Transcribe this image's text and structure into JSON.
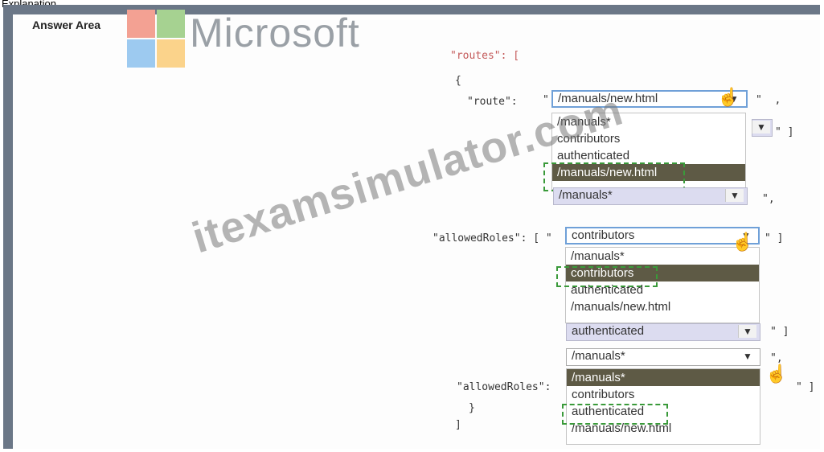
{
  "caption": "Explanation",
  "answer_area": "Answer Area",
  "logo_text": "Microsoft",
  "watermark": "itexamsimulator.com",
  "code": {
    "routes_line": "\"routes\": [",
    "open_brace": "{",
    "route_key": "\"route\":",
    "quote": "\"",
    "comma_after": "\"  ,",
    "close_bracket_1": "\" ]",
    "after_mid": "\",",
    "allowed_roles_1": "\"allowedRoles\": [ \"",
    "close_after_c": "\" ]",
    "close_after_auth": "\" ]",
    "after_manuals": "\",",
    "allowed_roles_2": "\"allowedRoles\":",
    "close_after_last": "\" ]",
    "close_brace": "}",
    "close_routes": "]"
  },
  "dropdown1": {
    "selected": "/manuals/new.html",
    "options": [
      "/manuals*",
      "contributors",
      "authenticated",
      "/manuals/new.html"
    ],
    "highlighted_index": 3
  },
  "dropdown2": {
    "selected": "/manuals*"
  },
  "dropdown3": {
    "selected": "contributors",
    "options": [
      "/manuals*",
      "contributors",
      "authenticated",
      "/manuals/new.html"
    ],
    "highlighted_index": 1
  },
  "dropdown4": {
    "selected": "authenticated"
  },
  "dropdown5": {
    "selected": "/manuals*",
    "options": [
      "/manuals*",
      "contributors",
      "authenticated",
      "/manuals/new.html"
    ],
    "highlighted_index": 0
  },
  "icons": {
    "dropdown_arrow": "▼",
    "cursor": "hand-pointer"
  }
}
